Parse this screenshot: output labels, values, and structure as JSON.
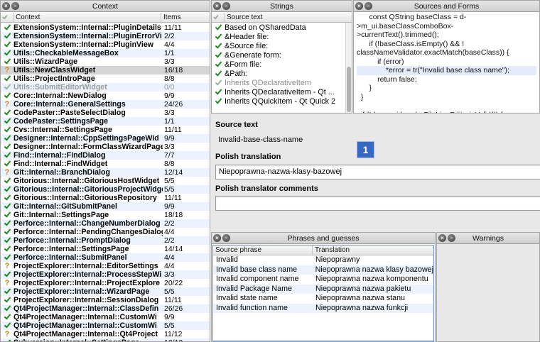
{
  "context": {
    "title": "Context",
    "col_context": "Context",
    "col_items": "Items",
    "rows": [
      {
        "name": "ExtensionSystem::Internal::PluginDetails",
        "count": "11/11",
        "icon": "check",
        "dim": false
      },
      {
        "name": "ExtensionSystem::Internal::PluginErrorVi",
        "count": "2/2",
        "icon": "check",
        "dim": false
      },
      {
        "name": "ExtensionSystem::Internal::PluginView",
        "count": "4/4",
        "icon": "check",
        "dim": false
      },
      {
        "name": "Utils::CheckableMessageBox",
        "count": "1/1",
        "icon": "check",
        "dim": false
      },
      {
        "name": "Utils::WizardPage",
        "count": "3/3",
        "icon": "check",
        "dim": false
      },
      {
        "name": "Utils::NewClassWidget",
        "count": "16/18",
        "icon": "question",
        "dim": false
      },
      {
        "name": "Utils::ProjectIntroPage",
        "count": "8/8",
        "icon": "check",
        "dim": false
      },
      {
        "name": "Utils::SubmitEditorWidget",
        "count": "0/0",
        "icon": "check",
        "dim": true
      },
      {
        "name": "Core::Internal::NewDialog",
        "count": "9/9",
        "icon": "check",
        "dim": false
      },
      {
        "name": "Core::Internal::GeneralSettings",
        "count": "24/26",
        "icon": "question",
        "dim": false
      },
      {
        "name": "CodePaster::PasteSelectDialog",
        "count": "3/3",
        "icon": "check",
        "dim": false
      },
      {
        "name": "CodePaster::SettingsPage",
        "count": "1/1",
        "icon": "check",
        "dim": false
      },
      {
        "name": "Cvs::Internal::SettingsPage",
        "count": "11/11",
        "icon": "check",
        "dim": false
      },
      {
        "name": "Designer::Internal::CppSettingsPageWid",
        "count": "9/9",
        "icon": "check",
        "dim": false
      },
      {
        "name": "Designer::Internal::FormClassWizardPage",
        "count": "3/3",
        "icon": "check",
        "dim": false
      },
      {
        "name": "Find::Internal::FindDialog",
        "count": "7/7",
        "icon": "check",
        "dim": false
      },
      {
        "name": "Find::Internal::FindWidget",
        "count": "8/8",
        "icon": "check",
        "dim": false
      },
      {
        "name": "Git::Internal::BranchDialog",
        "count": "12/14",
        "icon": "question",
        "dim": false
      },
      {
        "name": "Gitorious::Internal::GitoriousHostWidget",
        "count": "5/5",
        "icon": "check",
        "dim": false
      },
      {
        "name": "Gitorious::Internal::GitoriousProjectWidge",
        "count": "5/5",
        "icon": "check",
        "dim": false
      },
      {
        "name": "Gitorious::Internal::GitoriousRepository",
        "count": "11/11",
        "icon": "check",
        "dim": false
      },
      {
        "name": "Git::Internal::GitSubmitPanel",
        "count": "9/9",
        "icon": "check",
        "dim": false
      },
      {
        "name": "Git::Internal::SettingsPage",
        "count": "18/18",
        "icon": "check",
        "dim": false
      },
      {
        "name": "Perforce::Internal::ChangeNumberDialog",
        "count": "2/2",
        "icon": "check",
        "dim": false
      },
      {
        "name": "Perforce::Internal::PendingChangesDialog",
        "count": "4/4",
        "icon": "check",
        "dim": false
      },
      {
        "name": "Perforce::Internal::PromptDialog",
        "count": "2/2",
        "icon": "check",
        "dim": false
      },
      {
        "name": "Perforce::Internal::SettingsPage",
        "count": "14/14",
        "icon": "check",
        "dim": false
      },
      {
        "name": "Perforce::Internal::SubmitPanel",
        "count": "4/4",
        "icon": "check",
        "dim": false
      },
      {
        "name": "ProjectExplorer::Internal::EditorSettings",
        "count": "4/4",
        "icon": "question",
        "dim": false
      },
      {
        "name": "ProjectExplorer::Internal::ProcessStepWi",
        "count": "3/3",
        "icon": "check",
        "dim": false
      },
      {
        "name": "ProjectExplorer::Internal::ProjectExplore",
        "count": "20/22",
        "icon": "question",
        "dim": false
      },
      {
        "name": "ProjectExplorer::Internal::WizardPage",
        "count": "5/5",
        "icon": "check",
        "dim": false
      },
      {
        "name": "ProjectExplorer::Internal::SessionDialog",
        "count": "11/11",
        "icon": "check",
        "dim": false
      },
      {
        "name": "Qt4ProjectManager::Internal::ClassDefin",
        "count": "26/26",
        "icon": "check",
        "dim": false
      },
      {
        "name": "Qt4ProjectManager::Internal::CustomWi",
        "count": "9/9",
        "icon": "check",
        "dim": false
      },
      {
        "name": "Qt4ProjectManager::Internal::CustomWi",
        "count": "5/5",
        "icon": "check",
        "dim": false
      },
      {
        "name": "Qt4ProjectManager::Internal::Qt4Project",
        "count": "11/12",
        "icon": "question",
        "dim": false
      },
      {
        "name": "Subversion::Internal::SettingsPage",
        "count": "12/12",
        "icon": "check",
        "dim": false
      }
    ]
  },
  "strings": {
    "title": "Strings",
    "col_source": "Source text",
    "rows": [
      {
        "text": "Based on QSharedData",
        "dim": false
      },
      {
        "text": "&Header file:",
        "dim": false
      },
      {
        "text": "&Source file:",
        "dim": false
      },
      {
        "text": "&Generate form:",
        "dim": false
      },
      {
        "text": "&Form file:",
        "dim": false
      },
      {
        "text": "&Path:",
        "dim": false
      },
      {
        "text": "Inherits QDeclarativeItem",
        "dim": true
      },
      {
        "text": "Inherits QDeclarativeItem - Qt ...",
        "dim": false
      },
      {
        "text": "Inherits QQuickItem - Qt Quick 2",
        "dim": false
      }
    ]
  },
  "sources": {
    "title": "Sources and Forms",
    "lines": [
      "      const QString baseClass = d-",
      ">m_ui.baseClassComboBox-",
      ">currentText().trimmed();",
      "      if (!baseClass.isEmpty() && !",
      "classNameValidator.exactMatch(baseClass)) {",
      "          if (error)",
      "              *error = tr(\"Invalid base class name\");",
      "          return false;",
      "      }",
      "  }",
      "",
      "  if (!d->m_ui.headerFileLineEdit->isValid()) {"
    ],
    "highlight_line": 6
  },
  "editor": {
    "source_label": "Source text",
    "source_value": "Invalid-base-class-name",
    "translation_label": "Polish translation",
    "translation_value": "Niepoprawna-nazwa-klasy-bazowej",
    "comments_label": "Polish translator comments",
    "comments_value": "",
    "badge": "1"
  },
  "phrases": {
    "title": "Phrases and guesses",
    "col_source": "Source phrase",
    "col_translation": "Translation",
    "rows": [
      {
        "source": "Invalid",
        "translation": "Niepoprawny"
      },
      {
        "source": "Invalid base class name",
        "translation": "Niepoprawna nazwa klasy bazowej"
      },
      {
        "source": "Invalid component name",
        "translation": "Niepoprawna nazwa komponentu"
      },
      {
        "source": "Invalid Package Name",
        "translation": "Niepoprawna nazwa pakietu"
      },
      {
        "source": "Invalid state name",
        "translation": "Niepoprawna nazwa stanu"
      },
      {
        "source": "Invalid function name",
        "translation": "Niepoprawna nazwa funkcji"
      }
    ]
  },
  "warnings": {
    "title": "Warnings"
  },
  "window_buttons": {
    "close": "×",
    "float": "▫"
  },
  "colors": {
    "accent": "#3568c3",
    "check": "#1e8a1e",
    "question": "#c88a0f",
    "selection": "#d5d5d5",
    "alt_row": "#edf3fe"
  }
}
